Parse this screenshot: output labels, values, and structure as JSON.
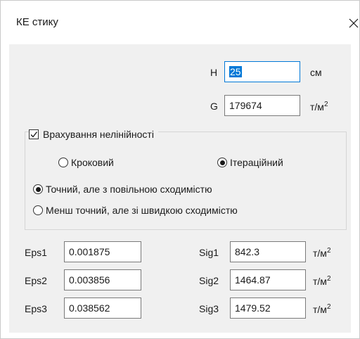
{
  "window": {
    "title": "КЕ стику",
    "close_glyph": "✕"
  },
  "section_thickness": {
    "label": "H",
    "value": "25",
    "unit": "см"
  },
  "shear_modulus": {
    "label": "G",
    "value": "179674",
    "unit_base": "т/м",
    "unit_exp": "2"
  },
  "nonlinearity": {
    "checkbox_label": "Врахування нелінійності",
    "checked": true,
    "step_radio_label": "Кроковий",
    "iterative_radio_label": "Ітераційний",
    "iterative_selected": true,
    "precise_radio_label": "Точний, але з повільною сходимістю",
    "precise_selected": true,
    "fast_radio_label": "Менш точний, але зі швидкою сходимістю"
  },
  "diagram_points": [
    {
      "eps_label": "Eps1",
      "eps_value": "0.001875",
      "sig_label": "Sig1",
      "sig_value": "842.3",
      "unit_base": "т/м",
      "unit_exp": "2"
    },
    {
      "eps_label": "Eps2",
      "eps_value": "0.003856",
      "sig_label": "Sig2",
      "sig_value": "1464.87",
      "unit_base": "т/м",
      "unit_exp": "2"
    },
    {
      "eps_label": "Eps3",
      "eps_value": "0.038562",
      "sig_label": "Sig3",
      "sig_value": "1479.52",
      "unit_base": "т/м",
      "unit_exp": "2"
    }
  ],
  "colors": {
    "selection": "#0078d7",
    "panel_background": "#f0f0f0"
  }
}
